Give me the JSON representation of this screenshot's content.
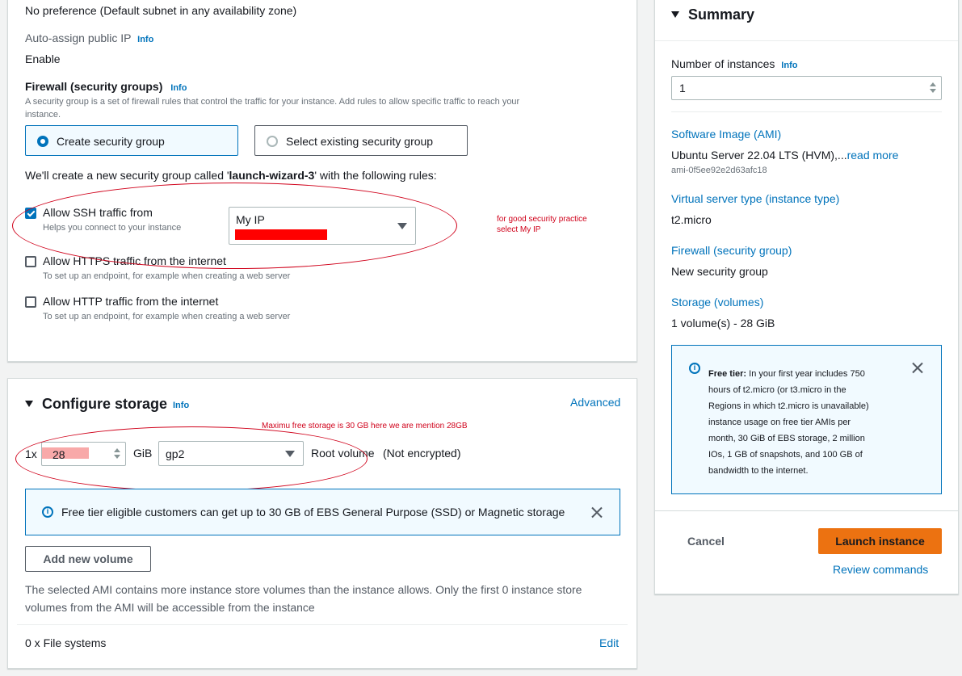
{
  "network": {
    "subnet_value": "No preference (Default subnet in any availability zone)",
    "auto_ip_label": "Auto-assign public IP",
    "info": "Info",
    "auto_ip_value": "Enable",
    "firewall_label": "Firewall (security groups)",
    "firewall_desc_1": "A security group is a set of firewall rules that control the traffic for your instance. Add rules to allow specific traffic to reach your",
    "firewall_desc_2": "instance.",
    "create_sg": "Create security group",
    "select_existing_sg": "Select existing security group",
    "rules_prefix": "We'll create a new security group called '",
    "sg_name": "launch-wizard-3",
    "rules_suffix": "' with the following rules:",
    "ssh_label": "Allow SSH traffic from",
    "ssh_desc": "Helps you connect to your instance",
    "ssh_source": "My IP",
    "https_label": "Allow HTTPS traffic from the internet",
    "https_desc": "To set up an endpoint, for example when creating a web server",
    "http_label": "Allow HTTP traffic from the internet",
    "http_desc": "To set up an endpoint, for example when creating a web server",
    "annotation_1": "for good security practice",
    "annotation_2": "select My IP"
  },
  "storage": {
    "title": "Configure storage",
    "info": "Info",
    "advanced": "Advanced",
    "annotation": "Maximu free storage is 30 GB here we are mention 28GB",
    "multiplier": "1x",
    "size": "28",
    "unit": "GiB",
    "volume_type": "gp2",
    "root_volume": "Root volume",
    "encryption": "(Not encrypted)",
    "alert": "Free tier eligible customers can get up to 30 GB of EBS General Purpose (SSD) or Magnetic storage",
    "add_volume": "Add new volume",
    "note_1": "The selected AMI contains more instance store volumes than the instance allows. Only the first 0 instance store",
    "note_2": "volumes from the AMI will be accessible from the instance",
    "file_systems": "0 x File systems",
    "edit": "Edit"
  },
  "summary": {
    "title": "Summary",
    "instances_label": "Number of instances",
    "info": "Info",
    "instances_value": "1",
    "ami_label": "Software Image (AMI)",
    "ami_value": "Ubuntu Server 22.04 LTS (HVM),...",
    "read_more": "read more",
    "ami_id": "ami-0f5ee92e2d63afc18",
    "instance_type_label": "Virtual server type (instance type)",
    "instance_type_value": "t2.micro",
    "firewall_label": "Firewall (security group)",
    "firewall_value": "New security group",
    "storage_label": "Storage (volumes)",
    "storage_value": "1 volume(s) - 28 GiB",
    "free_tier_bold": "Free tier:",
    "free_tier_lines": [
      " In your first year includes 750",
      "hours of t2.micro (or t3.micro in the",
      "Regions in which t2.micro is unavailable)",
      "instance usage on free tier AMIs per",
      "month, 30 GiB of EBS storage, 2 million",
      "IOs, 1 GB of snapshots, and 100 GB of",
      "bandwidth to the internet."
    ],
    "cancel": "Cancel",
    "launch": "Launch instance",
    "review": "Review commands"
  },
  "colors": {
    "accent": "#0073bb",
    "launch": "#ec7211",
    "annotation": "#d0021b"
  }
}
